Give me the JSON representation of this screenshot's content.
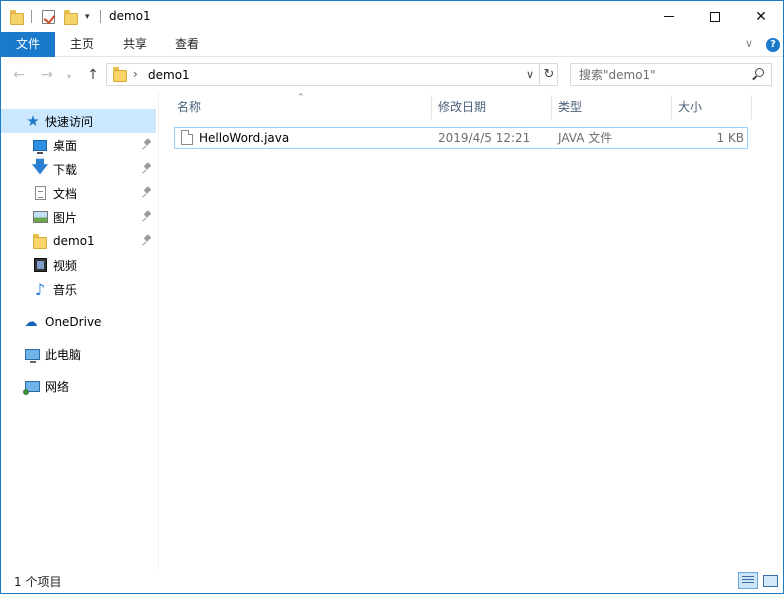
{
  "window": {
    "title": "demo1",
    "minimize_glyph": "",
    "maximize_glyph": "",
    "close_glyph": "✕"
  },
  "quick_access_toolbar": {
    "dropdown_glyph": "▾"
  },
  "ribbon": {
    "tabs": [
      {
        "label": "文件"
      },
      {
        "label": "主页"
      },
      {
        "label": "共享"
      },
      {
        "label": "查看"
      }
    ],
    "collapse_glyph": "∨",
    "help_glyph": "?"
  },
  "navigation": {
    "back_glyph": "←",
    "forward_glyph": "→",
    "recent_glyph": "▾",
    "up_glyph": "↑",
    "breadcrumb_separator": "›",
    "path": "demo1",
    "address_dropdown_glyph": "∨",
    "refresh_glyph": "↻",
    "search_placeholder": "搜索\"demo1\""
  },
  "sidebar": {
    "quick_access": {
      "label": "快速访问",
      "icon": "star-icon"
    },
    "pinned_items": [
      {
        "label": "桌面",
        "icon": "desktop-icon",
        "pinned": true
      },
      {
        "label": "下载",
        "icon": "download-icon",
        "pinned": true
      },
      {
        "label": "文档",
        "icon": "document-icon",
        "pinned": true
      },
      {
        "label": "图片",
        "icon": "pictures-icon",
        "pinned": true
      },
      {
        "label": "demo1",
        "icon": "folder-icon",
        "pinned": true
      },
      {
        "label": "视频",
        "icon": "video-icon",
        "pinned": false
      },
      {
        "label": "音乐",
        "icon": "music-icon",
        "pinned": false
      }
    ],
    "onedrive": {
      "label": "OneDrive",
      "icon": "cloud-icon"
    },
    "this_pc": {
      "label": "此电脑",
      "icon": "computer-icon"
    },
    "network": {
      "label": "网络",
      "icon": "network-icon"
    }
  },
  "file_list": {
    "columns": {
      "name": "名称",
      "modified": "修改日期",
      "type": "类型",
      "size": "大小"
    },
    "sort_glyph": "⌃",
    "rows": [
      {
        "name": "HelloWord.java",
        "modified": "2019/4/5 12:21",
        "type": "JAVA 文件",
        "size": "1 KB"
      }
    ]
  },
  "status_bar": {
    "item_count": "1 个项目"
  },
  "colors": {
    "accent": "#1979ca",
    "selection": "#cce8ff",
    "row_border": "#99d1ff",
    "window_border": "#1e7bc8"
  }
}
